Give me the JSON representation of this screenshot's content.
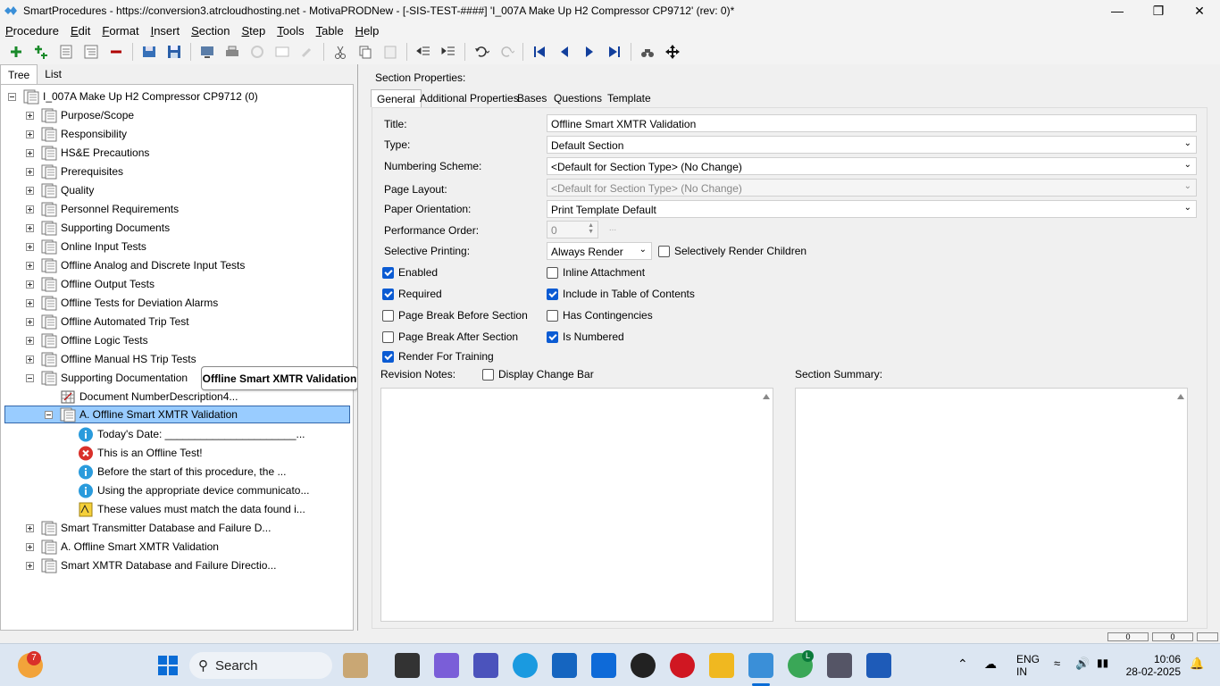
{
  "window": {
    "title": "SmartProcedures - https://conversion3.atrcloudhosting.net - MotivaPRODNew - [-SIS-TEST-####] 'I_007A Make Up H2 Compressor CP9712' (rev: 0)*",
    "minimize": "—",
    "restore": "❐",
    "close": "✕"
  },
  "menu": [
    {
      "label": "Procedure",
      "u": "P",
      "rest": "rocedure"
    },
    {
      "label": "Edit",
      "u": "E",
      "rest": "dit"
    },
    {
      "label": "Format",
      "u": "F",
      "rest": "ormat"
    },
    {
      "label": "Insert",
      "u": "I",
      "rest": "nsert"
    },
    {
      "label": "Section",
      "u": "S",
      "rest": "ection"
    },
    {
      "label": "Step",
      "u": "S",
      "rest": "tep"
    },
    {
      "label": "Tools",
      "u": "T",
      "rest": "ools"
    },
    {
      "label": "Table",
      "u": "T",
      "rest": "able"
    },
    {
      "label": "Help",
      "u": "H",
      "rest": "elp"
    }
  ],
  "left": {
    "tabs": [
      "Tree",
      "List"
    ],
    "tree": {
      "root": "I_007A Make Up H2 Compressor CP9712 (0)",
      "sections": [
        "Purpose/Scope",
        "Responsibility",
        "HS&E Precautions",
        "Prerequisites",
        "Quality",
        "Personnel Requirements",
        "Supporting Documents",
        "Online Input Tests",
        "Offline Analog and Discrete Input Tests",
        "Offline Output Tests",
        "Offline Tests for Deviation Alarms",
        "Offline Automated Trip Test",
        "Offline Logic Tests",
        "Offline Manual HS Trip Tests",
        "Supporting Documentation"
      ],
      "doc_number": "Document NumberDescription4...",
      "selected": "A. Offline Smart XMTR Validation",
      "steps": [
        "Today's Date: ______________________...",
        "This is an Offline Test!",
        "Before the start of this procedure, the ...",
        "Using the appropriate device communicato...",
        "These values must match the data found i..."
      ],
      "after": [
        "Smart Transmitter Database and Failure D...",
        "A. Offline Smart XMTR Validation",
        "Smart XMTR Database and Failure Directio..."
      ]
    },
    "tooltip": "Offline Smart XMTR Validation"
  },
  "right": {
    "header": "Section Properties:",
    "tabs": [
      "General",
      "Additional Properties",
      "Bases",
      "Questions",
      "Template"
    ],
    "labels": {
      "title": "Title:",
      "type": "Type:",
      "numbering": "Numbering Scheme:",
      "layout": "Page Layout:",
      "orientation": "Paper Orientation:",
      "perf": "Performance Order:",
      "selective": "Selective Printing:",
      "revision": "Revision Notes:",
      "summary": "Section Summary:"
    },
    "values": {
      "title": "Offline Smart XMTR Validation",
      "type": "Default Section",
      "numbering": "<Default for Section Type> (No Change)",
      "layout": "<Default for Section Type> (No Change)",
      "orientation": "Print Template Default",
      "perf": "0",
      "selective": "Always Render",
      "perf_btn": "..."
    },
    "checkboxes": {
      "selectively_render_children": {
        "label": "Selectively Render Children",
        "checked": false
      },
      "enabled": {
        "label": "Enabled",
        "checked": true
      },
      "inline_attachment": {
        "label": "Inline Attachment",
        "checked": false
      },
      "required": {
        "label": "Required",
        "checked": true
      },
      "include_toc": {
        "label": "Include in Table of Contents",
        "checked": true
      },
      "page_break_before": {
        "label": "Page Break Before Section",
        "checked": false
      },
      "has_contingencies": {
        "label": "Has Contingencies",
        "checked": false
      },
      "page_break_after": {
        "label": "Page Break After Section",
        "checked": false
      },
      "is_numbered": {
        "label": "Is Numbered",
        "checked": true
      },
      "render_training": {
        "label": "Render For Training",
        "checked": true
      },
      "display_change_bar": {
        "label": "Display Change Bar",
        "checked": false
      }
    }
  },
  "status": {
    "box1": "0",
    "box2": "0"
  },
  "taskbar": {
    "search": "Search",
    "badge": "7",
    "lang1": "ENG",
    "lang2": "IN",
    "time": "10:06",
    "date": "28-02-2025",
    "chrome_badge": "L"
  },
  "colors": {
    "selection": "#99ccff",
    "checkbox": "#0b5bd3",
    "info_icon": "#2a9bdc",
    "error_icon": "#d9302a"
  }
}
